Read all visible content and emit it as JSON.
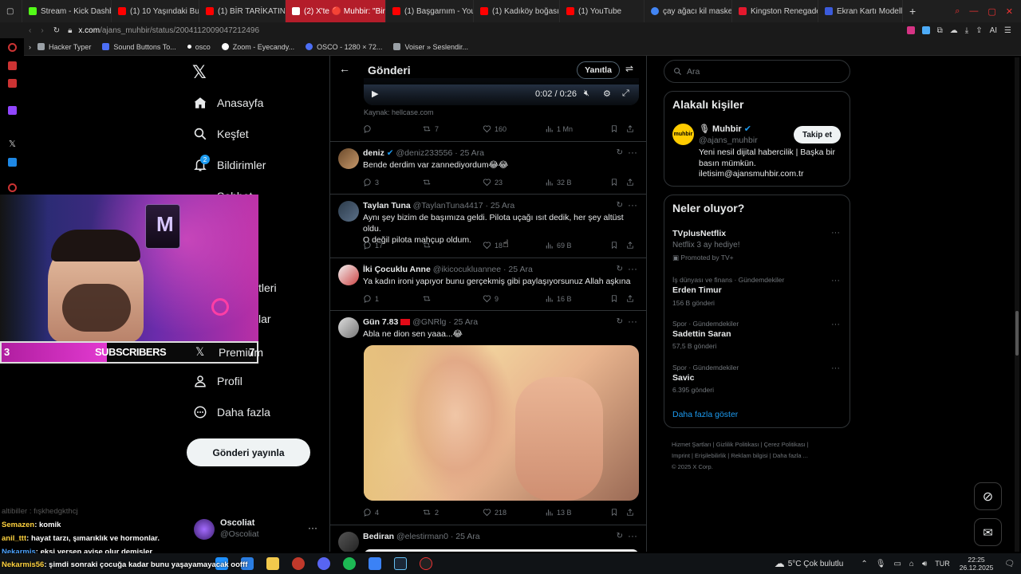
{
  "browser": {
    "tabs": [
      {
        "label": "Stream - Kick Dashbo",
        "color": "#53fc18"
      },
      {
        "label": "(1) 10 Yaşındaki Bu K",
        "color": "#ff0000"
      },
      {
        "label": "(1) BİR TARİKATIN KO",
        "color": "#ff0000"
      },
      {
        "label": "(2) X'te 🔴 Muhbir: \"Bir ka",
        "color": "#ffffff"
      },
      {
        "label": "(1) Başgarnım - YouTu",
        "color": "#ff0000"
      },
      {
        "label": "(1) Kadıköy boğası fa",
        "color": "#ff0000"
      },
      {
        "label": "(1) YouTube",
        "color": "#ff0000"
      },
      {
        "label": "çay ağacı kil maske",
        "color": "#4285f4"
      },
      {
        "label": "Kingston Renegade",
        "color": "#e3182d"
      },
      {
        "label": "Ekran Kartı Modelleri",
        "color": "#3b5bdb"
      }
    ],
    "url": "x.com/ajans_muhbir/status/2004112009047212496",
    "url_host": "x.com",
    "url_path": "/ajans_muhbir/status/2004112009047212496",
    "bookmarks": [
      {
        "label": "Hacker Typer",
        "color": "#9aa0a6"
      },
      {
        "label": "Sound Buttons To...",
        "color": "#4c6ef5"
      },
      {
        "label": "osco",
        "color": "#ffffff"
      },
      {
        "label": "Zoom - Eyecandy...",
        "color": "#ffffff"
      },
      {
        "label": "OSCO - 1280 × 72...",
        "color": "#4c6ef5"
      },
      {
        "label": "Voiser » Seslendir...",
        "color": "#9aa0a6"
      }
    ]
  },
  "nav": {
    "items": [
      {
        "label": "Anasayfa",
        "icon": "home-icon"
      },
      {
        "label": "Keşfet",
        "icon": "search-icon"
      },
      {
        "label": "Bildirimler",
        "icon": "bell-icon",
        "badge": "2"
      },
      {
        "label": "Sohbet",
        "icon": "chat-icon"
      },
      {
        "label": "tleri",
        "icon": "list-icon"
      },
      {
        "label": "lar",
        "icon": "people-icon"
      },
      {
        "label": "Premium",
        "icon": "x-logo-icon"
      },
      {
        "label": "Profil",
        "icon": "person-icon"
      },
      {
        "label": "Daha fazla",
        "icon": "more-circle-icon"
      }
    ],
    "post_button": "Gönderi yayınla",
    "account": {
      "name": "Oscoliat",
      "handle": "@Oscoliat"
    }
  },
  "header": {
    "title": "Gönderi",
    "reply_button": "Yanıtla"
  },
  "video": {
    "time": "0:02 / 0:26",
    "source": "Kaynak: hellcase.com",
    "stats": {
      "reply": "",
      "retweet": "7",
      "like": "160",
      "views": "1 Mn"
    }
  },
  "tweets": [
    {
      "name": "deniz",
      "verified": true,
      "handle": "@deniz233556",
      "date": "· 25 Ara",
      "text": "Bende derdim var zannediyordum😂😂",
      "reply": "3",
      "retweet": "",
      "like": "23",
      "views": "32 B"
    },
    {
      "name": "Taylan Tuna",
      "verified": false,
      "handle": "@TaylanTuna4417",
      "date": "· 25 Ara",
      "text": "Aynı şey bizim de başımıza geldi.  Pilota uçağı ısıt dedik, her şey altüst oldu.\nO değil pilota mahçup oldum.",
      "reply": "17",
      "retweet": "",
      "like": "18",
      "views": "69 B"
    },
    {
      "name": "İki Çocuklu Anne",
      "verified": false,
      "handle": "@ikicocukluannee",
      "date": "· 25 Ara",
      "text": "Ya kadın ironi yapıyor bunu gerçekmiş gibi paylaşıyorsunuz Allah aşkına",
      "reply": "1",
      "retweet": "",
      "like": "9",
      "views": "16 B"
    },
    {
      "name": "Gün 7.83",
      "verified": false,
      "handle": "@GNRlg",
      "date": "· 25 Ara",
      "text": "Abla ne dion sen yaaa...😂",
      "reply": "4",
      "retweet": "2",
      "like": "218",
      "views": "13 B"
    },
    {
      "name": "Bediran",
      "verified": false,
      "handle": "@elestirman0",
      "date": "· 25 Ara",
      "text": "",
      "reply": "",
      "retweet": "",
      "like": "",
      "views": ""
    }
  ],
  "search": {
    "placeholder": "Ara"
  },
  "related": {
    "title": "Alakalı kişiler",
    "name": "Muhbir",
    "handle": "@ajans_muhbir",
    "bio": "Yeni nesil dijital habercilik | Başka bir basın mümkün.\niletisim@ajansmuhbir.com.tr",
    "follow": "Takip et",
    "logo_text": "muhbir"
  },
  "trends": {
    "title": "Neler oluyor?",
    "promoted": {
      "name": "TVplusNetflix",
      "desc": "Netflix 3 ay hediye!",
      "by": "Promoted by TV+"
    },
    "items": [
      {
        "category": "İş dünyası ve finans · Gündemdekiler",
        "name": "Erden Timur",
        "count": "156 B gönderi"
      },
      {
        "category": "Spor · Gündemdekiler",
        "name": "Sadettin Saran",
        "count": "57,5 B gönderi"
      },
      {
        "category": "Spor · Gündemdekiler",
        "name": "Savic",
        "count": "6.395 gönderi"
      }
    ],
    "show_more": "Daha fazla göster"
  },
  "footer": {
    "links": [
      "Hizmet Şartları",
      "Gizlilik Politikası",
      "Çerez Politikası",
      "Imprint",
      "Erişilebilirlik",
      "Reklam bilgisi",
      "Daha fazla ..."
    ],
    "copyright": "© 2025 X Corp."
  },
  "overlay": {
    "subs_count": "3",
    "subs_label": "SUBSCRIBERS",
    "subs_end": "7",
    "chat": [
      {
        "user": "Semazen",
        "msg": ": komik",
        "color": "#ffd23f"
      },
      {
        "user": "anil_ttt",
        "msg": ": hayat tarzı, şımarıklık ve hormonlar.",
        "color": "#ffd23f"
      },
      {
        "user": "Nekarmis",
        "msg": ": ekşi yersen ayişe olur demişler",
        "color": "#4da3ff"
      },
      {
        "user": "Nekarmis56",
        "msg": ": şimdi sonraki çocuğa kadar bunu yaşayamayacak oofff",
        "color": "#ffd23f"
      }
    ],
    "faded_chat": "altibiller : fışkhedgkthcj"
  },
  "taskbar": {
    "weather": "5°C  Çok bulutlu",
    "lang": "TUR",
    "time": "22:25",
    "date": "26.12.2025"
  }
}
